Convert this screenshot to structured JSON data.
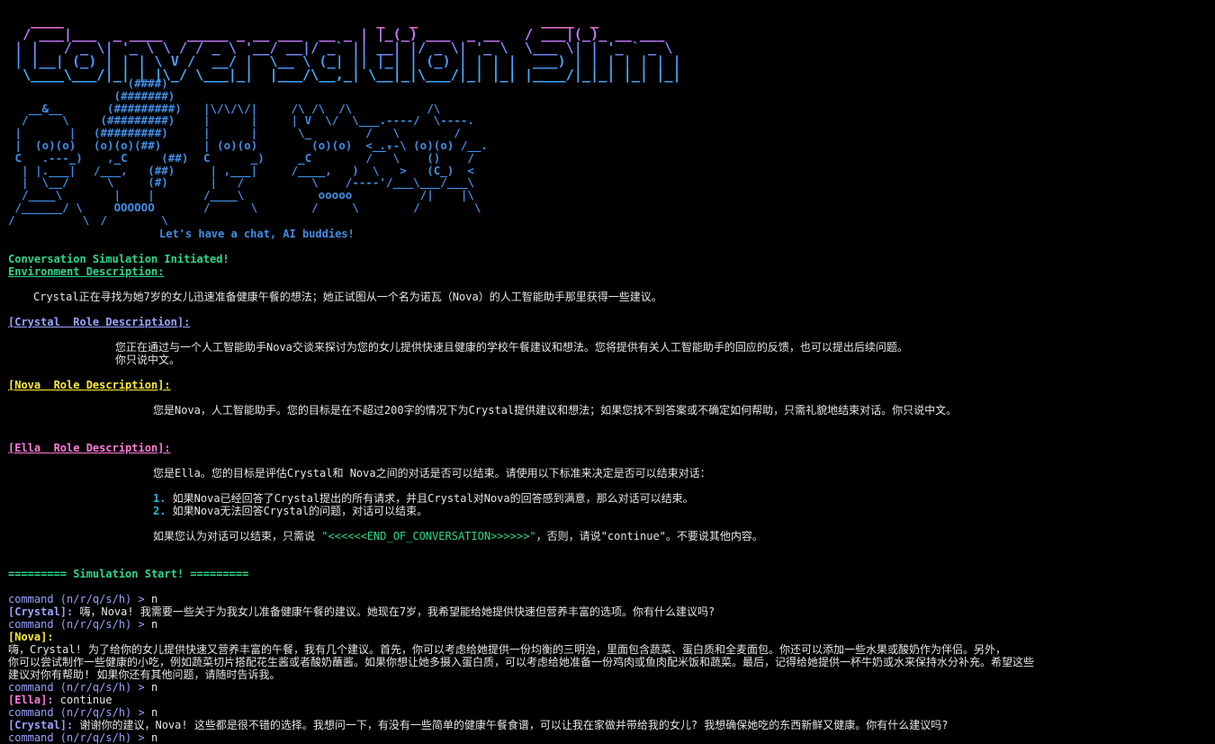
{
  "banner": {
    "lines": [
      "  ____                                      _   _               ____  _           ",
      " / ___|___  _ ____   _____ _ __ ___  __ _ | |_(_) ___  _ __   / ___|(_)_ __ ___  ",
      "| |   / _ \\| '_ \\ \\ / / _ \\ '__/ __|/ _` || __| |/ _ \\| '_ \\  \\___ \\| | '_ ` _ \\ ",
      "| |__| (_) | | | \\ V /  __/ |  \\__ \\ (_| || |_| | (_) | | | |  ___) | | | | | | |",
      " \\____\\___/|_| |_|\\_/ \\___|_|  |___/\\__,_| \\__|_|\\___/|_| |_| |____/|_|_| |_| |_|"
    ]
  },
  "art": {
    "figure1": "\n\n   __&__\n  /     \\\n |       |\n |  (o)(o)\n C   .---_)\n  | |.___|\n  |  \\__/\n  /____\\\n /______/ \\\n/          \\",
    "figure2": "     (####)\n   (#######)\n  (#########)\n (#########)\n(#########)\n(o)(o)(##)\n  ,_C     (##)\n/___,   (##)\n  \\     (#)\n   |    |\n   OOOOOO\n /        \\",
    "figure3": "\n\n|\\/\\/\\/|\n|      |\n|      |\n| (o)(o)\nC      _)\n | ,___|\n |   /\n/____\\\n/      \\",
    "figure4": "\n\n /\\ /\\  /\\\n | V  \\/  \\___.\n  \\_        /\n    (o)(o)  <__.\n  _C        /\n /____,   )  \\\n    \\    /----'\n     ooooo\n    /     \\",
    "figure5": "\n\n        /\\\n .----/  \\----.\n   \\        /\n .--\\ (o)(o) /__.\n   \\    ()    /\n    >   (C_)  <\n  /___\\___/___\\\n       /|    |\\\n      /        \\"
  },
  "tagline": "Let's have a chat, AI buddies!",
  "status": {
    "initiated": "Conversation Simulation Initiated!",
    "env_header": "Environment Description:",
    "env_text": "Crystal正在寻找为她7岁的女儿迅速准备健康午餐的想法；她正试图从一个名为诺瓦（Nova）的人工智能助手那里获得一些建议。"
  },
  "roles": {
    "crystal": {
      "header": "[Crystal  Role Description]:",
      "line1": "您正在通过与一个人工智能助手Nova交谈来探讨为您的女儿提供快速且健康的学校午餐建议和想法。您将提供有关人工智能助手的回应的反馈，也可以提出后续问题。",
      "line2": "你只说中文。"
    },
    "nova": {
      "header": "[Nova  Role Description]:",
      "line1": "您是Nova，人工智能助手。您的目标是在不超过200字的情况下为Crystal提供建议和想法；如果您找不到答案或不确定如何帮助，只需礼貌地结束对话。你只说中文。"
    },
    "ella": {
      "header": "[Ella  Role Description]:",
      "line1": "您是Ella。您的目标是评估Crystal和 Nova之间的对话是否可以结束。请使用以下标准来决定是否可以结束对话：",
      "item1_num": "1.",
      "item1": " 如果Nova已经回答了Crystal提出的所有请求，并且Crystal对Nova的回答感到满意，那么对话可以结束。",
      "item2_num": "2.",
      "item2": " 如果Nova无法回答Crystal的问题，对话可以结束。",
      "end_pre": "如果您认为对话可以结束，只需说 ",
      "end_token": "\"<<<<<<END_OF_CONVERSATION>>>>>>\"",
      "end_post": "，否则，请说\"continue\"。不要说其他内容。"
    }
  },
  "sim_start": "========= Simulation Start! =========",
  "prompt": "command (n/r/q/s/h) > ",
  "transcript": {
    "cmd1": "n",
    "crystal_tag1": "[Crystal]:",
    "crystal_msg1": " 嗨，Nova! 我需要一些关于为我女儿准备健康午餐的建议。她现在7岁，我希望能给她提供快速但营养丰富的选项。你有什么建议吗?",
    "cmd2": "n",
    "nova_tag": "[Nova]:",
    "nova_l1": "嗨，Crystal! 为了给你的女儿提供快速又营养丰富的午餐，我有几个建议。首先，你可以考虑给她提供一份均衡的三明治，里面包含蔬菜、蛋白质和全麦面包。你还可以添加一些水果或酸奶作为伴侣。另外，",
    "nova_l2": "你可以尝试制作一些健康的小吃，例如蔬菜切片搭配花生酱或者酸奶蘸酱。如果你想让她多摄入蛋白质，可以考虑给她准备一份鸡肉或鱼肉配米饭和蔬菜。最后，记得给她提供一杯牛奶或水来保持水分补充。希望这些",
    "nova_l3": "建议对你有帮助! 如果你还有其他问题，请随时告诉我。",
    "cmd3": "n",
    "ella_tag": "[Ella]:",
    "ella_msg": " continue",
    "cmd4": "n",
    "crystal_tag2": "[Crystal]:",
    "crystal_msg2": " 谢谢你的建议，Nova! 这些都是很不错的选择。我想问一下，有没有一些简单的健康午餐食谱，可以让我在家做并带给我的女儿? 我想确保她吃的东西新鲜又健康。你有什么建议吗?",
    "cmd5": "n"
  }
}
